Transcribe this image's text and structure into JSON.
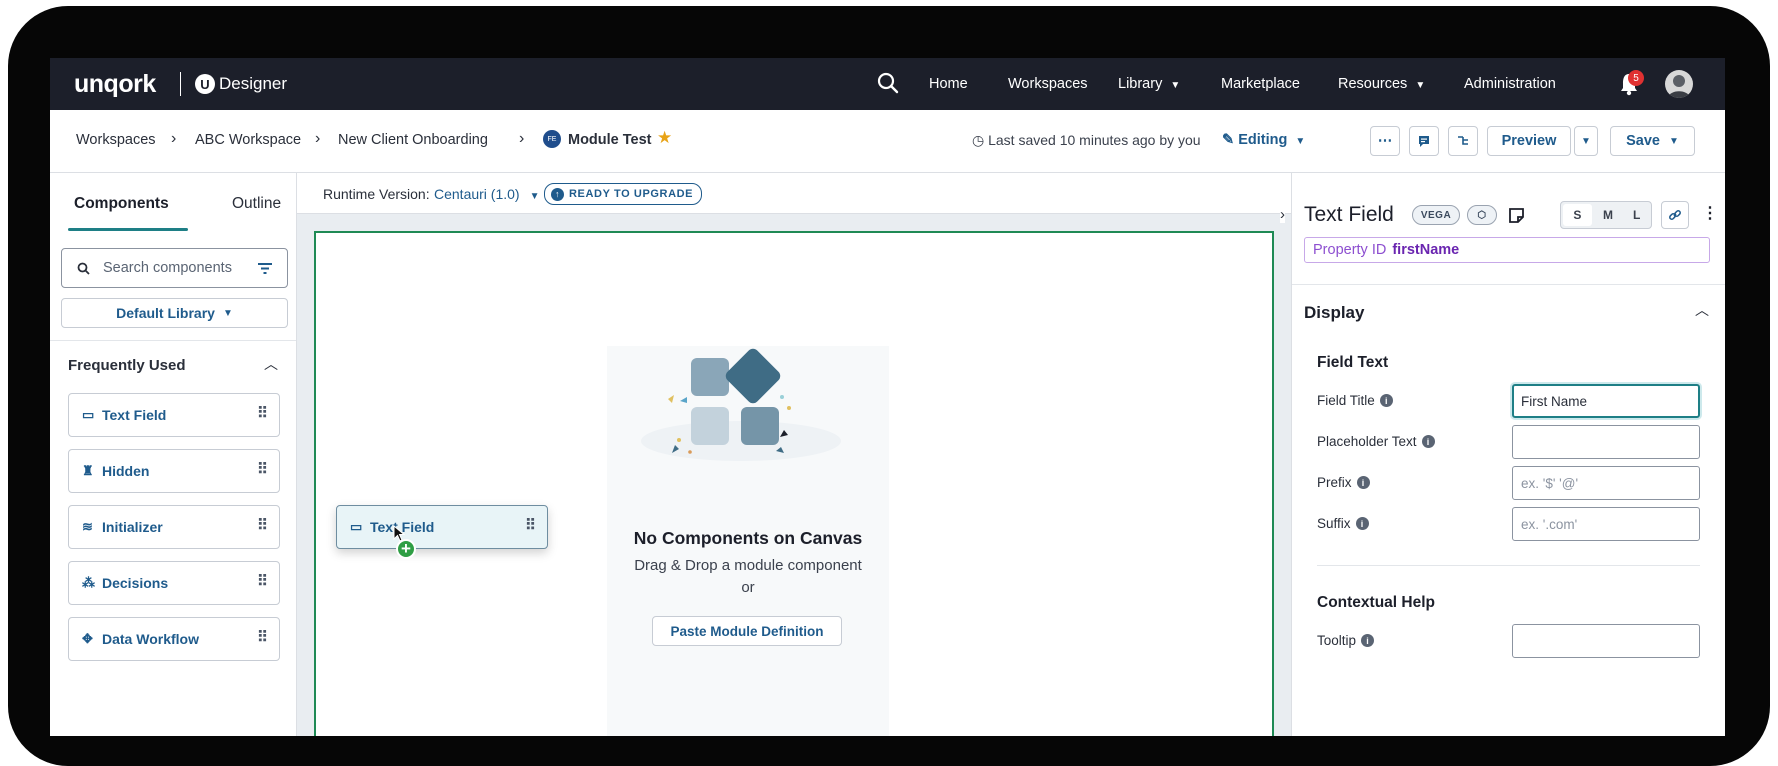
{
  "topbar": {
    "logo": "unqork",
    "product": "Designer",
    "nav": [
      "Home",
      "Workspaces",
      "Library",
      "Marketplace",
      "Resources",
      "Administration"
    ],
    "notifications_count": "5"
  },
  "breadcrumb": {
    "items": [
      "Workspaces",
      "ABC Workspace",
      "New Client Onboarding"
    ],
    "module_badge": "FE",
    "module_name": "Module Test",
    "last_saved": "Last saved 10 minutes ago by you",
    "mode": "Editing",
    "more_label": "⋯",
    "preview_label": "Preview",
    "save_label": "Save"
  },
  "left_panel": {
    "tabs": [
      "Components",
      "Outline"
    ],
    "search_placeholder": "Search components",
    "library": "Default Library",
    "section_title": "Frequently Used",
    "components": [
      {
        "label": "Text Field",
        "icon": "textfield-icon"
      },
      {
        "label": "Hidden",
        "icon": "hidden-icon"
      },
      {
        "label": "Initializer",
        "icon": "initializer-icon"
      },
      {
        "label": "Decisions",
        "icon": "decisions-icon"
      },
      {
        "label": "Data Workflow",
        "icon": "workflow-icon"
      }
    ]
  },
  "canvas": {
    "runtime_label": "Runtime Version:",
    "runtime_value": "Centauri (1.0)",
    "upgrade_label": "READY TO UPGRADE",
    "empty_title": "No Components on Canvas",
    "empty_sub1": "Drag & Drop a module component",
    "empty_sub2": "or",
    "paste_button": "Paste Module Definition",
    "dragging_label": "Text Field"
  },
  "right_panel": {
    "title": "Text Field",
    "badge": "VEGA",
    "sizes": [
      "S",
      "M",
      "L"
    ],
    "property_id_label": "Property ID",
    "property_id_value": "firstName",
    "section": "Display",
    "field_text_heading": "Field Text",
    "fields": [
      {
        "label": "Field Title",
        "value": "First Name",
        "placeholder": ""
      },
      {
        "label": "Placeholder Text",
        "value": "",
        "placeholder": ""
      },
      {
        "label": "Prefix",
        "value": "",
        "placeholder": "ex. '$' '@'"
      },
      {
        "label": "Suffix",
        "value": "",
        "placeholder": "ex. '.com'"
      }
    ],
    "contextual_help_heading": "Contextual Help",
    "tooltip_label": "Tooltip"
  },
  "colors": {
    "topbar": "#1c1f2a",
    "accent": "#1e7f86",
    "link": "#1f5b8c",
    "canvas_border": "#1f8a55"
  }
}
